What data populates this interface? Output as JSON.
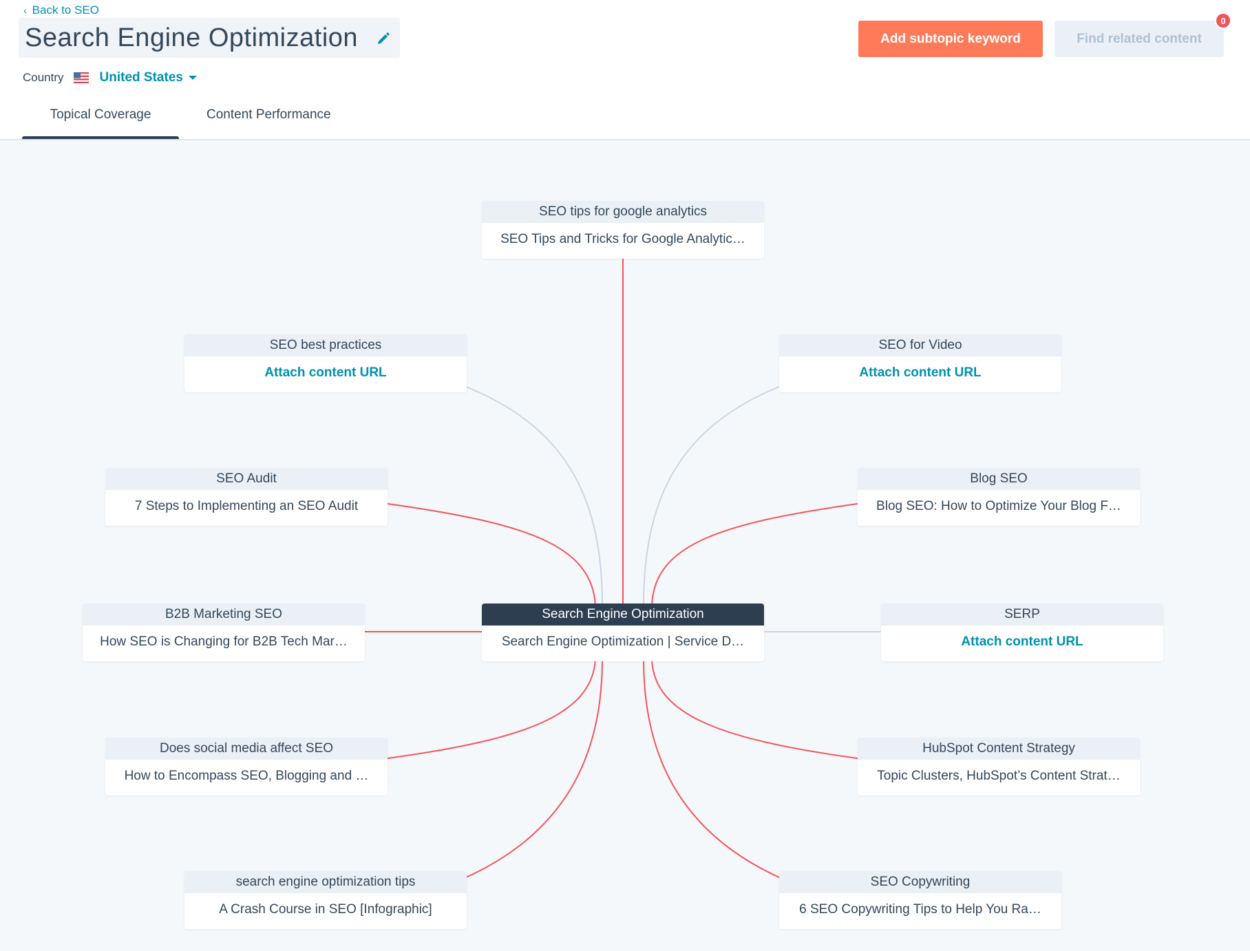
{
  "header": {
    "back_label": "Back to SEO",
    "title": "Search Engine Optimization",
    "country_label": "Country",
    "country_value": "United States",
    "add_button": "Add subtopic keyword",
    "find_button": "Find related content",
    "badge_count": "0",
    "tabs": [
      {
        "label": "Topical Coverage",
        "active": true
      },
      {
        "label": "Content Performance",
        "active": false
      }
    ]
  },
  "colors": {
    "primary_button": "#ff7a59",
    "link": "#0091ae",
    "center_header": "#2d3e50",
    "connector_attached": "#f2545b",
    "connector_empty": "#cbd6e2",
    "badge": "#f2545b"
  },
  "cluster": {
    "center": {
      "keyword": "Search Engine Optimization",
      "content": "Search Engine Optimization | Service D…"
    },
    "subtopics": [
      {
        "id": "top",
        "keyword": "SEO tips for google analytics",
        "content": "SEO Tips and Tricks for Google Analytic…",
        "attached": true
      },
      {
        "id": "best",
        "keyword": "SEO best practices",
        "content": "Attach content URL",
        "attached": false
      },
      {
        "id": "video",
        "keyword": "SEO for Video",
        "content": "Attach content URL",
        "attached": false
      },
      {
        "id": "audit",
        "keyword": "SEO Audit",
        "content": "7 Steps to Implementing an SEO Audit",
        "attached": true
      },
      {
        "id": "blog",
        "keyword": "Blog SEO",
        "content": "Blog SEO: How to Optimize Your Blog F…",
        "attached": true
      },
      {
        "id": "b2b",
        "keyword": "B2B Marketing SEO",
        "content": "How SEO is Changing for B2B Tech Mar…",
        "attached": true
      },
      {
        "id": "serp",
        "keyword": "SERP",
        "content": "Attach content URL",
        "attached": false
      },
      {
        "id": "social",
        "keyword": "Does social media affect SEO",
        "content": "How to Encompass SEO, Blogging and …",
        "attached": true
      },
      {
        "id": "hubspot",
        "keyword": "HubSpot Content Strategy",
        "content": "Topic Clusters, HubSpot’s Content Strat…",
        "attached": true
      },
      {
        "id": "tips",
        "keyword": "search engine optimization tips",
        "content": "A Crash Course in SEO [Infographic]",
        "attached": true
      },
      {
        "id": "copy",
        "keyword": "SEO Copywriting",
        "content": "6 SEO Copywriting Tips to Help You Ra…",
        "attached": true
      }
    ]
  }
}
